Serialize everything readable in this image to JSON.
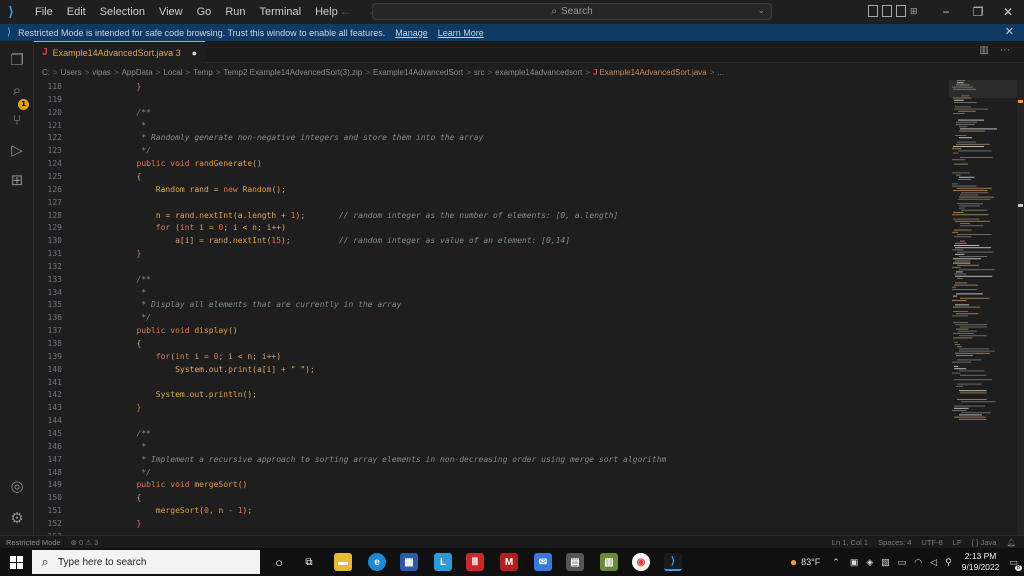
{
  "titlebar": {
    "menu": [
      "File",
      "Edit",
      "Selection",
      "View",
      "Go",
      "Run",
      "Terminal",
      "Help"
    ],
    "search_placeholder": "Search",
    "window_controls": {
      "minimize": "−",
      "restore": "❐",
      "close": "✕"
    }
  },
  "banner": {
    "message": "Restricted Mode is intended for safe code browsing. Trust this window to enable all features.",
    "manage_link": "Manage",
    "learn_more_link": "Learn More"
  },
  "activity_bar": {
    "icons": [
      "explorer-icon",
      "search-icon",
      "source-control-icon",
      "run-debug-icon",
      "extensions-icon",
      "account-icon",
      "settings-gear-icon"
    ],
    "badge": "1"
  },
  "tab": {
    "label": "Example14AdvancedSort.java 3",
    "icon_text": "J",
    "modified_dot": "●"
  },
  "breadcrumb": {
    "items": [
      "C:",
      "Users",
      "vipas",
      "AppData",
      "Local",
      "Temp",
      "Temp2 Example14AdvancedSort(3).zip",
      "Example14AdvancedSort",
      "src",
      "example14advancedsort",
      "Example14AdvancedSort.java",
      "..."
    ]
  },
  "code_lines": [
    {
      "n": "118",
      "html": "        <span class='t-kw'>}</span>"
    },
    {
      "n": "119",
      "html": ""
    },
    {
      "n": "120",
      "html": "        <span class='t-comment'>/**</span>"
    },
    {
      "n": "121",
      "html": "         <span class='t-comment'>*</span>"
    },
    {
      "n": "122",
      "html": "         <span class='t-comment'>* Randomly generate non-negative integers and store them into the array</span>"
    },
    {
      "n": "123",
      "html": "         <span class='t-comment'>*/</span>"
    },
    {
      "n": "124",
      "html": "        <span class='t-kw'>public void</span> <span class='t-fn'>randGenerate</span><span class='t-plain'>()</span>"
    },
    {
      "n": "125",
      "html": "        <span class='t-plain'>{</span>"
    },
    {
      "n": "126",
      "html": "            <span class='t-type'>Random</span> <span class='t-plain'>rand = </span><span class='t-kw'>new</span> <span class='t-fn'>Random</span><span class='t-plain'>();</span>"
    },
    {
      "n": "127",
      "html": ""
    },
    {
      "n": "128",
      "html": "            <span class='t-plain'>n = rand.</span><span class='t-fn'>nextInt</span><span class='t-plain'>(a.length + </span><span class='t-num'>1</span><span class='t-plain'>);</span>       <span class='t-comment'>// random integer as the number of elements: [0, a.length]</span>"
    },
    {
      "n": "129",
      "html": "            <span class='t-kw'>for</span> <span class='t-plain'>(</span><span class='t-kw'>int</span> <span class='t-plain'>i = </span><span class='t-num'>0</span><span class='t-plain'>; i &lt; n; i++)</span>"
    },
    {
      "n": "130",
      "html": "                <span class='t-plain'>a[i] = rand.</span><span class='t-fn'>nextInt</span><span class='t-plain'>(</span><span class='t-num'>15</span><span class='t-plain'>);</span>          <span class='t-comment'>// random integer as value of an element: [0,14]</span>"
    },
    {
      "n": "131",
      "html": "        <span class='t-kw'>}</span>"
    },
    {
      "n": "132",
      "html": ""
    },
    {
      "n": "133",
      "html": "        <span class='t-comment'>/**</span>"
    },
    {
      "n": "134",
      "html": "         <span class='t-comment'>*</span>"
    },
    {
      "n": "135",
      "html": "         <span class='t-comment'>* Display all elements that are currently in the array</span>"
    },
    {
      "n": "136",
      "html": "         <span class='t-comment'>*/</span>"
    },
    {
      "n": "137",
      "html": "        <span class='t-kw'>public void</span> <span class='t-fn'>display</span><span class='t-plain'>()</span>"
    },
    {
      "n": "138",
      "html": "        <span class='t-plain'>{</span>"
    },
    {
      "n": "139",
      "html": "            <span class='t-kw'>for</span><span class='t-plain'>(</span><span class='t-kw'>int</span> <span class='t-plain'>i = </span><span class='t-num'>0</span><span class='t-plain'>; i &lt; n; i++)</span>"
    },
    {
      "n": "140",
      "html": "                <span class='t-type'>System</span><span class='t-plain'>.out.</span><span class='t-fn'>print</span><span class='t-plain'>(a[i] + </span><span class='t-str'>\" \"</span><span class='t-plain'>);</span>"
    },
    {
      "n": "141",
      "html": ""
    },
    {
      "n": "142",
      "html": "            <span class='t-type'>System</span><span class='t-plain'>.out.</span><span class='t-fn'>println</span><span class='t-plain'>();</span>"
    },
    {
      "n": "143",
      "html": "        <span class='t-kw'>}</span>"
    },
    {
      "n": "144",
      "html": ""
    },
    {
      "n": "145",
      "html": "        <span class='t-comment'>/**</span>"
    },
    {
      "n": "146",
      "html": "         <span class='t-comment'>*</span>"
    },
    {
      "n": "147",
      "html": "         <span class='t-comment'>* Implement a recursive approach to sorting array elements in non-decreasing order using merge sort algorithm</span>"
    },
    {
      "n": "148",
      "html": "         <span class='t-comment'>*/</span>"
    },
    {
      "n": "149",
      "html": "        <span class='t-kw'>public void</span> <span class='t-fn'>mergeSort</span><span class='t-plain'>()</span>"
    },
    {
      "n": "150",
      "html": "        <span class='t-plain'>{</span>"
    },
    {
      "n": "151",
      "html": "            <span class='t-fn'>mergeSort</span><span class='t-plain'>(</span><span class='t-num'>0</span><span class='t-plain'>, n - </span><span class='t-num'>1</span><span class='t-plain'>);</span>"
    },
    {
      "n": "152",
      "html": "        <span class='t-kw'>}</span>"
    },
    {
      "n": "153",
      "html": ""
    }
  ],
  "statusbar": {
    "restricted": "Restricted Mode",
    "problems": "⊗ 0 ⚠ 3",
    "position": "Ln 1, Col 1",
    "spaces": "Spaces: 4",
    "encoding": "UTF-8",
    "eol": "LF",
    "language": "{ } Java"
  },
  "taskbar": {
    "search_placeholder": "Type here to search",
    "temperature": "83°F",
    "time": "2:13 PM",
    "date": "9/19/2022",
    "notification_count": "8"
  },
  "colors": {
    "accent": "#f0a030",
    "banner_bg": "#0e3a63",
    "vscode_blue": "#3aa0f0"
  }
}
